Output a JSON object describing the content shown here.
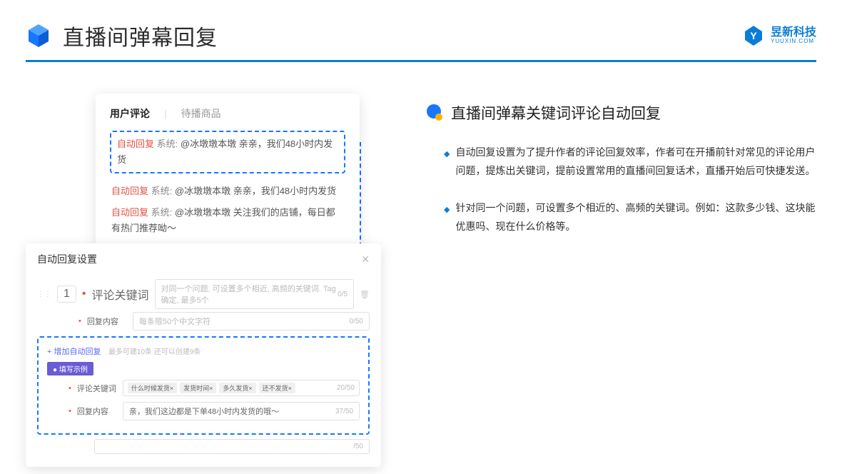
{
  "header": {
    "title": "直播间弹幕回复",
    "brand_cn": "昱新科技",
    "brand_en": "YUUXIN.COM"
  },
  "comments_card": {
    "tab_active": "用户评论",
    "tab_other": "待播商品",
    "auto_tag": "自动回复",
    "sys_tag": "系统:",
    "hl_text": "@冰墩墩本墩 亲亲，我们48小时内发货",
    "line2": "@冰墩墩本墩 亲亲，我们48小时内发货",
    "line3": "@冰墩墩本墩 关注我们的店铺，每日都有热门推荐呦～"
  },
  "settings_card": {
    "title": "自动回复设置",
    "index": "1",
    "kw_label": "评论关键词",
    "kw_placeholder": "对同一个问题, 可设置多个相近, 高频的关键词. Tag确定, 最多5个",
    "kw_count": "0/5",
    "content_label": "回复内容",
    "content_placeholder": "每条限50个中文字符",
    "content_count": "0/50",
    "add_link": "+ 增加自动回复",
    "add_hint": "最多可建10条 还可以创建9条",
    "example_badge": "● 填写示例",
    "ex_kw_label": "评论关键词",
    "ex_tags": [
      "什么时候发货×",
      "发货时间×",
      "多久发货×",
      "还不发货×"
    ],
    "ex_kw_count": "20/50",
    "ex_content_label": "回复内容",
    "ex_content_text": "亲，我们这边都是下单48小时内发货的哦～",
    "ex_content_count": "37/50",
    "bottom_count": "/50"
  },
  "right": {
    "section_title": "直播间弹幕关键词评论自动回复",
    "bullet1": "自动回复设置为了提升作者的评论回复效率，作者可在开播前针对常见的评论用户问题，提炼出关键词，提前设置常用的直播间回复话术，直播开始后可快捷发送。",
    "bullet2": "针对同一个问题，可设置多个相近的、高频的关键词。例如：这款多少钱、这块能优惠吗、现在什么价格等。"
  }
}
